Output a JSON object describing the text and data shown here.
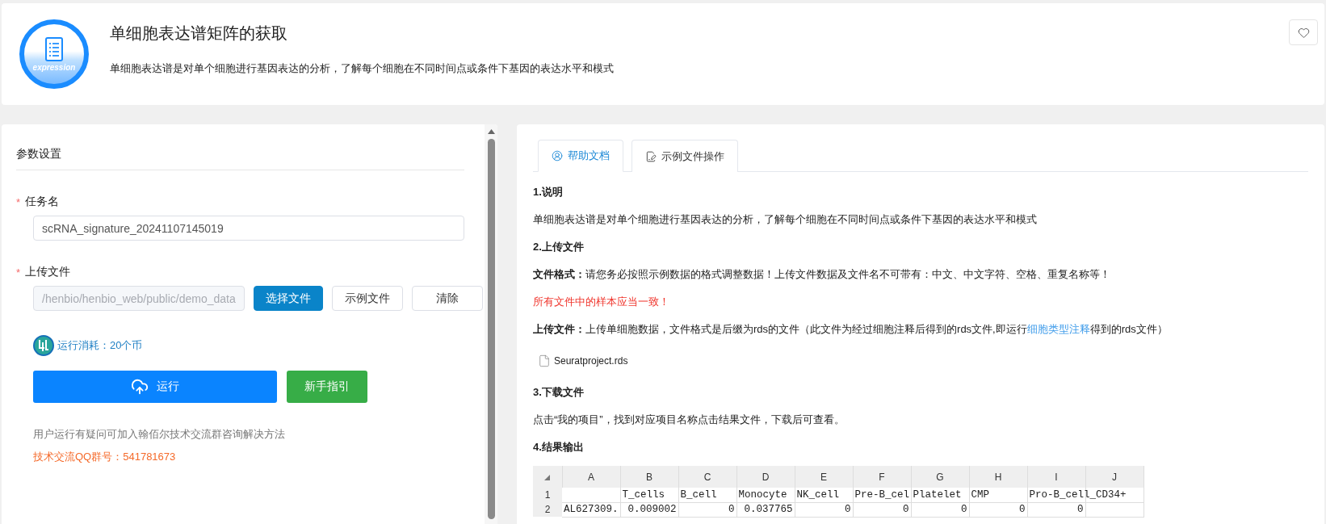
{
  "header": {
    "logo_text": "expression",
    "title": "单细胞表达谱矩阵的获取",
    "description": "单细胞表达谱是对单个细胞进行基因表达的分析，了解每个细胞在不同时间点或条件下基因的表达水平和模式"
  },
  "params": {
    "title": "参数设置",
    "fields": [
      {
        "kind": "text",
        "mark": "*",
        "label": "任务名",
        "value": "scRNA_signature_20241107145019",
        "disabled": false
      },
      {
        "kind": "file",
        "mark": "*",
        "label": "上传文件",
        "value": "/henbio/henbio_web/public/demo_data",
        "disabled": true,
        "buttons": [
          {
            "label": "选择文件",
            "kind": "primary"
          },
          {
            "label": "示例文件",
            "kind": "default"
          },
          {
            "label": "清除",
            "kind": "default"
          }
        ]
      }
    ],
    "cost": "运行消耗：20个币",
    "run_button": "运行",
    "guide_button": "新手指引",
    "help_text": "用户运行有疑问可加入翰佰尔技术交流群咨询解决方法",
    "qq_text": "技术交流QQ群号：541781673"
  },
  "tabs": [
    {
      "label": "帮助文档",
      "kind": "help",
      "selected": true
    },
    {
      "label": "示例文件操作",
      "kind": "edit",
      "selected": false
    }
  ],
  "help": [
    {
      "kind": "heading",
      "text": "1.说明"
    },
    {
      "kind": "text",
      "text": "单细胞表达谱是对单个细胞进行基因表达的分析，了解每个细胞在不同时间点或条件下基因的表达水平和模式"
    },
    {
      "kind": "heading",
      "text": "2.上传文件"
    },
    {
      "kind": "text",
      "text": "**文件格式：**请您务必按照示例数据的格式调整数据！上传文件数据及文件名不可带有：中文、中文字符、空格、重复名称等！"
    },
    {
      "kind": "warning",
      "text": "所有文件中的样本应当一致！"
    },
    {
      "kind": "link_text",
      "label": "上传文件：",
      "before": "上传单细胞数据，文件格式是后缀为rds的文件（此文件为经过细胞注释后得到的rds文件,即运行",
      "link": "细胞类型注释",
      "after": "得到的rds文件）"
    },
    {
      "kind": "file",
      "text": "Seuratproject.rds"
    },
    {
      "kind": "heading",
      "text": "3.下载文件"
    },
    {
      "kind": "text",
      "text": "点击“我的项目”，找到对应项目名称点击结果文件，下载后可查看。"
    },
    {
      "kind": "heading",
      "text": "4.结果输出"
    },
    {
      "kind": "sheet",
      "columns": [
        "A",
        "B",
        "C",
        "D",
        "E",
        "F",
        "G",
        "H",
        "I",
        "J"
      ],
      "rows": [
        {
          "num": "1",
          "cells": [
            "",
            "T_cells",
            "B_cell",
            "Monocyte",
            "NK_cell",
            "Pre-B_cel",
            "Platelet",
            "CMP",
            "Pro-B_cell_CD34+",
            ""
          ]
        },
        {
          "num": "2",
          "cells": [
            "AL627309.",
            "0.009002",
            "0",
            "0.037765",
            "0",
            "0",
            "0",
            "0",
            "0",
            ""
          ]
        }
      ]
    }
  ]
}
